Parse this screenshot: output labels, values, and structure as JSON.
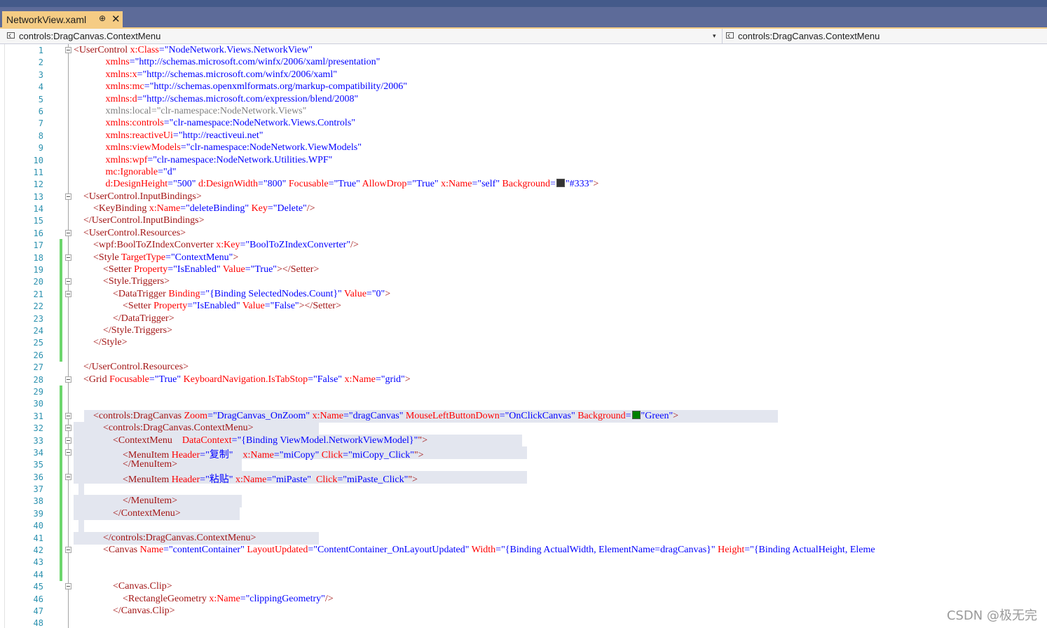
{
  "tab": {
    "title": "NetworkView.xaml",
    "pin_glyph": "⊕",
    "close_glyph": "✕"
  },
  "nav": {
    "left": "controls:DragCanvas.ContextMenu",
    "right": "controls:DragCanvas.ContextMenu",
    "dropdown_glyph": "▾"
  },
  "colors": {
    "swatch_333": "#333333",
    "swatch_green": "#008000"
  },
  "watermark": "CSDN @极无完",
  "lines": [
    {
      "n": "1",
      "fold": true,
      "chg": false,
      "tokens": [
        [
          "b",
          "<"
        ],
        [
          "t",
          "UserControl"
        ],
        [
          "a",
          " x:Class"
        ],
        [
          "p",
          "="
        ],
        [
          "v",
          "\"NodeNetwork.Views.NetworkView\""
        ]
      ]
    },
    {
      "n": "2",
      "tokens": [
        [
          "s",
          "             "
        ],
        [
          "a",
          "xmlns"
        ],
        [
          "p",
          "="
        ],
        [
          "v",
          "\"http://schemas.microsoft.com/winfx/2006/xaml/presentation\""
        ]
      ]
    },
    {
      "n": "3",
      "tokens": [
        [
          "s",
          "             "
        ],
        [
          "a",
          "xmlns:x"
        ],
        [
          "p",
          "="
        ],
        [
          "v",
          "\"http://schemas.microsoft.com/winfx/2006/xaml\""
        ]
      ]
    },
    {
      "n": "4",
      "tokens": [
        [
          "s",
          "             "
        ],
        [
          "a",
          "xmlns:mc"
        ],
        [
          "p",
          "="
        ],
        [
          "v",
          "\"http://schemas.openxmlformats.org/markup-compatibility/2006\""
        ]
      ]
    },
    {
      "n": "5",
      "tokens": [
        [
          "s",
          "             "
        ],
        [
          "a",
          "xmlns:d"
        ],
        [
          "p",
          "="
        ],
        [
          "v",
          "\"http://schemas.microsoft.com/expression/blend/2008\""
        ]
      ]
    },
    {
      "n": "6",
      "tokens": [
        [
          "s",
          "             "
        ],
        [
          "g",
          "xmlns:local=\"clr-namespace:NodeNetwork.Views\""
        ]
      ]
    },
    {
      "n": "7",
      "tokens": [
        [
          "s",
          "             "
        ],
        [
          "a",
          "xmlns:controls"
        ],
        [
          "p",
          "="
        ],
        [
          "v",
          "\"clr-namespace:NodeNetwork.Views.Controls\""
        ]
      ]
    },
    {
      "n": "8",
      "tokens": [
        [
          "s",
          "             "
        ],
        [
          "a",
          "xmlns:reactiveUi"
        ],
        [
          "p",
          "="
        ],
        [
          "v",
          "\"http://reactiveui.net\""
        ]
      ]
    },
    {
      "n": "9",
      "tokens": [
        [
          "s",
          "             "
        ],
        [
          "a",
          "xmlns:viewModels"
        ],
        [
          "p",
          "="
        ],
        [
          "v",
          "\"clr-namespace:NodeNetwork.ViewModels\""
        ]
      ]
    },
    {
      "n": "10",
      "tokens": [
        [
          "s",
          "             "
        ],
        [
          "a",
          "xmlns:wpf"
        ],
        [
          "p",
          "="
        ],
        [
          "v",
          "\"clr-namespace:NodeNetwork.Utilities.WPF\""
        ]
      ]
    },
    {
      "n": "11",
      "tokens": [
        [
          "s",
          "             "
        ],
        [
          "a",
          "mc:Ignorable"
        ],
        [
          "p",
          "="
        ],
        [
          "v",
          "\"d\""
        ]
      ]
    },
    {
      "n": "12",
      "tokens": [
        [
          "s",
          "             "
        ],
        [
          "a",
          "d:DesignHeight"
        ],
        [
          "p",
          "="
        ],
        [
          "v",
          "\"500\""
        ],
        [
          "a",
          " d:DesignWidth"
        ],
        [
          "p",
          "="
        ],
        [
          "v",
          "\"800\""
        ],
        [
          "a",
          " Focusable"
        ],
        [
          "p",
          "="
        ],
        [
          "v",
          "\"True\""
        ],
        [
          "a",
          " AllowDrop"
        ],
        [
          "p",
          "="
        ],
        [
          "v",
          "\"True\""
        ],
        [
          "a",
          " x:Name"
        ],
        [
          "p",
          "="
        ],
        [
          "v",
          "\"self\""
        ],
        [
          "a",
          " Background"
        ],
        [
          "p",
          "="
        ],
        [
          "sw",
          "swatch_333"
        ],
        [
          "v",
          "\"#333\""
        ],
        [
          "b",
          ">"
        ]
      ]
    },
    {
      "n": "13",
      "fold": true,
      "tokens": [
        [
          "s",
          "    "
        ],
        [
          "b",
          "<"
        ],
        [
          "t",
          "UserControl.InputBindings"
        ],
        [
          "b",
          ">"
        ]
      ]
    },
    {
      "n": "14",
      "tokens": [
        [
          "s",
          "        "
        ],
        [
          "b",
          "<"
        ],
        [
          "t",
          "KeyBinding"
        ],
        [
          "a",
          " x:Name"
        ],
        [
          "p",
          "="
        ],
        [
          "v",
          "\"deleteBinding\""
        ],
        [
          "a",
          " Key"
        ],
        [
          "p",
          "="
        ],
        [
          "v",
          "\"Delete\""
        ],
        [
          "b",
          "/>"
        ]
      ]
    },
    {
      "n": "15",
      "tokens": [
        [
          "s",
          "    "
        ],
        [
          "b",
          "</"
        ],
        [
          "t",
          "UserControl.InputBindings"
        ],
        [
          "b",
          ">"
        ]
      ]
    },
    {
      "n": "16",
      "fold": true,
      "tokens": [
        [
          "s",
          "    "
        ],
        [
          "b",
          "<"
        ],
        [
          "t",
          "UserControl.Resources"
        ],
        [
          "b",
          ">"
        ]
      ]
    },
    {
      "n": "17",
      "chg": true,
      "tokens": [
        [
          "s",
          "        "
        ],
        [
          "b",
          "<"
        ],
        [
          "t",
          "wpf:BoolToZIndexConverter"
        ],
        [
          "a",
          " x:Key"
        ],
        [
          "p",
          "="
        ],
        [
          "v",
          "\"BoolToZIndexConverter\""
        ],
        [
          "b",
          "/>"
        ]
      ]
    },
    {
      "n": "18",
      "chg": true,
      "fold": true,
      "tokens": [
        [
          "s",
          "        "
        ],
        [
          "b",
          "<"
        ],
        [
          "t",
          "Style"
        ],
        [
          "a",
          " TargetType"
        ],
        [
          "p",
          "="
        ],
        [
          "v",
          "\"ContextMenu\""
        ],
        [
          "b",
          ">"
        ]
      ]
    },
    {
      "n": "19",
      "chg": true,
      "tokens": [
        [
          "s",
          "            "
        ],
        [
          "b",
          "<"
        ],
        [
          "t",
          "Setter"
        ],
        [
          "a",
          " Property"
        ],
        [
          "p",
          "="
        ],
        [
          "v",
          "\"IsEnabled\""
        ],
        [
          "a",
          " Value"
        ],
        [
          "p",
          "="
        ],
        [
          "v",
          "\"True\""
        ],
        [
          "b",
          "></"
        ],
        [
          "t",
          "Setter"
        ],
        [
          "b",
          ">"
        ]
      ]
    },
    {
      "n": "20",
      "chg": true,
      "fold": true,
      "tokens": [
        [
          "s",
          "            "
        ],
        [
          "b",
          "<"
        ],
        [
          "t",
          "Style.Triggers"
        ],
        [
          "b",
          ">"
        ]
      ]
    },
    {
      "n": "21",
      "chg": true,
      "fold": true,
      "tokens": [
        [
          "s",
          "                "
        ],
        [
          "b",
          "<"
        ],
        [
          "t",
          "DataTrigger"
        ],
        [
          "a",
          " Binding"
        ],
        [
          "p",
          "="
        ],
        [
          "v",
          "\"{Binding SelectedNodes.Count}\""
        ],
        [
          "a",
          " Value"
        ],
        [
          "p",
          "="
        ],
        [
          "v",
          "\"0\""
        ],
        [
          "b",
          ">"
        ]
      ]
    },
    {
      "n": "22",
      "chg": true,
      "tokens": [
        [
          "s",
          "                    "
        ],
        [
          "b",
          "<"
        ],
        [
          "t",
          "Setter"
        ],
        [
          "a",
          " Property"
        ],
        [
          "p",
          "="
        ],
        [
          "v",
          "\"IsEnabled\""
        ],
        [
          "a",
          " Value"
        ],
        [
          "p",
          "="
        ],
        [
          "v",
          "\"False\""
        ],
        [
          "b",
          "></"
        ],
        [
          "t",
          "Setter"
        ],
        [
          "b",
          ">"
        ]
      ]
    },
    {
      "n": "23",
      "chg": true,
      "tokens": [
        [
          "s",
          "                "
        ],
        [
          "b",
          "</"
        ],
        [
          "t",
          "DataTrigger"
        ],
        [
          "b",
          ">"
        ]
      ]
    },
    {
      "n": "24",
      "chg": true,
      "tokens": [
        [
          "s",
          "            "
        ],
        [
          "b",
          "</"
        ],
        [
          "t",
          "Style.Triggers"
        ],
        [
          "b",
          ">"
        ]
      ]
    },
    {
      "n": "25",
      "chg": true,
      "tokens": [
        [
          "s",
          "        "
        ],
        [
          "b",
          "</"
        ],
        [
          "t",
          "Style"
        ],
        [
          "b",
          ">"
        ]
      ]
    },
    {
      "n": "26",
      "chg": true,
      "tokens": []
    },
    {
      "n": "27",
      "tokens": [
        [
          "s",
          "    "
        ],
        [
          "b",
          "</"
        ],
        [
          "t",
          "UserControl.Resources"
        ],
        [
          "b",
          ">"
        ]
      ]
    },
    {
      "n": "28",
      "fold": true,
      "tokens": [
        [
          "s",
          "    "
        ],
        [
          "b",
          "<"
        ],
        [
          "t",
          "Grid"
        ],
        [
          "a",
          " Focusable"
        ],
        [
          "p",
          "="
        ],
        [
          "v",
          "\"True\""
        ],
        [
          "a",
          " KeyboardNavigation.IsTabStop"
        ],
        [
          "p",
          "="
        ],
        [
          "v",
          "\"False\""
        ],
        [
          "a",
          " x:Name"
        ],
        [
          "p",
          "="
        ],
        [
          "v",
          "\"grid\""
        ],
        [
          "b",
          ">"
        ]
      ]
    },
    {
      "n": "29",
      "chg": true,
      "tokens": []
    },
    {
      "n": "30",
      "chg": true,
      "tokens": []
    },
    {
      "n": "31",
      "chg": true,
      "fold": true,
      "sel": true,
      "tokens": [
        [
          "s",
          "        "
        ],
        [
          "b",
          "<"
        ],
        [
          "t",
          "controls:DragCanvas"
        ],
        [
          "a",
          " Zoom"
        ],
        [
          "p",
          "="
        ],
        [
          "v",
          "\"DragCanvas_OnZoom\""
        ],
        [
          "a",
          " x:Name"
        ],
        [
          "p",
          "="
        ],
        [
          "v",
          "\"dragCanvas\""
        ],
        [
          "a",
          " MouseLeftButtonDown"
        ],
        [
          "p",
          "="
        ],
        [
          "v",
          "\"OnClickCanvas\""
        ],
        [
          "a",
          " Background"
        ],
        [
          "p",
          "="
        ],
        [
          "sw",
          "swatch_green"
        ],
        [
          "v",
          "\"Green\""
        ],
        [
          "b",
          ">"
        ]
      ]
    },
    {
      "n": "32",
      "chg": true,
      "fold": true,
      "sel": true,
      "tokens": [
        [
          "s",
          "            "
        ],
        [
          "b",
          "<"
        ],
        [
          "t",
          "controls:DragCanvas.ContextMenu"
        ],
        [
          "b",
          ">"
        ]
      ]
    },
    {
      "n": "33",
      "chg": true,
      "fold": true,
      "sel": true,
      "tokens": [
        [
          "s",
          "                "
        ],
        [
          "b",
          "<"
        ],
        [
          "t",
          "ContextMenu"
        ],
        [
          "a",
          "    DataContext"
        ],
        [
          "p",
          "="
        ],
        [
          "v",
          "\"{Binding ViewModel.NetworkViewModel}\""
        ],
        [
          "b",
          "\">"
        ]
      ]
    },
    {
      "n": "34",
      "chg": true,
      "fold": true,
      "sel": true,
      "tokens": [
        [
          "s",
          "                    "
        ],
        [
          "b",
          "<"
        ],
        [
          "t",
          "MenuItem"
        ],
        [
          "a",
          " Header"
        ],
        [
          "p",
          "="
        ],
        [
          "v",
          "\"复制\""
        ],
        [
          "a",
          "    x:Name"
        ],
        [
          "p",
          "="
        ],
        [
          "v",
          "\"miCopy\""
        ],
        [
          "a",
          " Click"
        ],
        [
          "p",
          "="
        ],
        [
          "v",
          "\"miCopy_Click\""
        ],
        [
          "b",
          "\">"
        ]
      ]
    },
    {
      "n": "35",
      "chg": true,
      "sel": true,
      "tokens": [
        [
          "s",
          "                    "
        ],
        [
          "b",
          "</"
        ],
        [
          "t",
          "MenuItem"
        ],
        [
          "b",
          ">"
        ]
      ]
    },
    {
      "n": "36",
      "chg": true,
      "fold": true,
      "sel": true,
      "tokens": [
        [
          "s",
          "                    "
        ],
        [
          "b",
          "<"
        ],
        [
          "t",
          "MenuItem"
        ],
        [
          "a",
          " Header"
        ],
        [
          "p",
          "="
        ],
        [
          "v",
          "\"粘贴\""
        ],
        [
          "a",
          " x:Name"
        ],
        [
          "p",
          "="
        ],
        [
          "v",
          "\"miPaste\""
        ],
        [
          "a",
          "  Click"
        ],
        [
          "p",
          "="
        ],
        [
          "v",
          "\"miPaste_Click\""
        ],
        [
          "b",
          "\">"
        ]
      ]
    },
    {
      "n": "37",
      "chg": true,
      "sel": true,
      "tokens": []
    },
    {
      "n": "38",
      "chg": true,
      "sel": true,
      "tokens": [
        [
          "s",
          "                    "
        ],
        [
          "b",
          "</"
        ],
        [
          "t",
          "MenuItem"
        ],
        [
          "b",
          ">"
        ]
      ]
    },
    {
      "n": "39",
      "chg": true,
      "sel": true,
      "tokens": [
        [
          "s",
          "                "
        ],
        [
          "b",
          "</"
        ],
        [
          "t",
          "ContextMenu"
        ],
        [
          "b",
          ">"
        ]
      ]
    },
    {
      "n": "40",
      "chg": true,
      "sel": true,
      "tokens": []
    },
    {
      "n": "41",
      "chg": true,
      "sel": true,
      "tokens": [
        [
          "s",
          "            "
        ],
        [
          "b",
          "</"
        ],
        [
          "t",
          "controls:DragCanvas.ContextMenu"
        ],
        [
          "b",
          ">"
        ]
      ]
    },
    {
      "n": "42",
      "chg": true,
      "fold": true,
      "tokens": [
        [
          "s",
          "            "
        ],
        [
          "b",
          "<"
        ],
        [
          "t",
          "Canvas"
        ],
        [
          "a",
          " Name"
        ],
        [
          "p",
          "="
        ],
        [
          "v",
          "\"contentContainer\""
        ],
        [
          "a",
          " LayoutUpdated"
        ],
        [
          "p",
          "="
        ],
        [
          "v",
          "\"ContentContainer_OnLayoutUpdated\""
        ],
        [
          "a",
          " Width"
        ],
        [
          "p",
          "="
        ],
        [
          "v",
          "\"{Binding ActualWidth, ElementName=dragCanvas}\""
        ],
        [
          "a",
          " Height"
        ],
        [
          "p",
          "="
        ],
        [
          "v",
          "\"{Binding ActualHeight, Eleme"
        ]
      ]
    },
    {
      "n": "43",
      "chg": true,
      "tokens": []
    },
    {
      "n": "44",
      "chg": true,
      "tokens": []
    },
    {
      "n": "45",
      "fold": true,
      "tokens": [
        [
          "s",
          "                "
        ],
        [
          "b",
          "<"
        ],
        [
          "t",
          "Canvas.Clip"
        ],
        [
          "b",
          ">"
        ]
      ]
    },
    {
      "n": "46",
      "tokens": [
        [
          "s",
          "                    "
        ],
        [
          "b",
          "<"
        ],
        [
          "t",
          "RectangleGeometry"
        ],
        [
          "a",
          " x:Name"
        ],
        [
          "p",
          "="
        ],
        [
          "v",
          "\"clippingGeometry\""
        ],
        [
          "b",
          "/>"
        ]
      ]
    },
    {
      "n": "47",
      "tokens": [
        [
          "s",
          "                "
        ],
        [
          "b",
          "</"
        ],
        [
          "t",
          "Canvas.Clip"
        ],
        [
          "b",
          ">"
        ]
      ]
    },
    {
      "n": "48",
      "tokens": []
    }
  ]
}
